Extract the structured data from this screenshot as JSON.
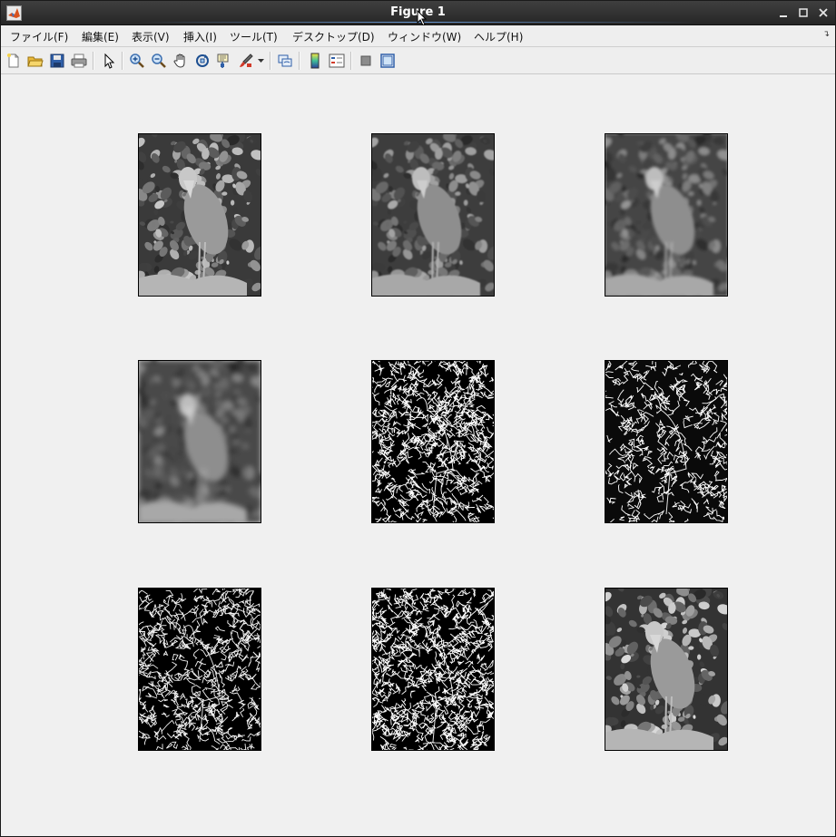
{
  "window": {
    "title": "Figure 1"
  },
  "menu": {
    "items": [
      {
        "label": "ファイル(F)"
      },
      {
        "label": "編集(E)"
      },
      {
        "label": "表示(V)"
      },
      {
        "label": "挿入(I)"
      },
      {
        "label": "ツール(T)"
      },
      {
        "label": "デスクトップ(D)"
      },
      {
        "label": "ウィンドウ(W)"
      },
      {
        "label": "ヘルプ(H)"
      }
    ]
  },
  "toolbar": {
    "buttons": [
      {
        "icon": "new-figure-icon"
      },
      {
        "icon": "open-file-icon"
      },
      {
        "icon": "save-icon"
      },
      {
        "icon": "print-icon"
      },
      {
        "icon": "edit-plot-arrow-icon"
      },
      {
        "icon": "zoom-in-icon"
      },
      {
        "icon": "zoom-out-icon"
      },
      {
        "icon": "pan-hand-icon"
      },
      {
        "icon": "rotate-3d-icon"
      },
      {
        "icon": "data-cursor-icon"
      },
      {
        "icon": "brush-icon"
      },
      {
        "icon": "link-plot-icon"
      },
      {
        "icon": "insert-colorbar-icon"
      },
      {
        "icon": "insert-legend-icon"
      },
      {
        "icon": "hide-plot-tools-icon"
      },
      {
        "icon": "show-plot-tools-icon"
      }
    ]
  },
  "subplots": [
    {
      "variant": "original-gray"
    },
    {
      "variant": "blur-light"
    },
    {
      "variant": "blur-medium"
    },
    {
      "variant": "blur-heavy"
    },
    {
      "variant": "edges-dense"
    },
    {
      "variant": "edges-threshold"
    },
    {
      "variant": "edges-sparse"
    },
    {
      "variant": "edges-white"
    },
    {
      "variant": "sharpened"
    }
  ],
  "colors": {
    "titlebar": "#2e2e2e",
    "figure_bg": "#f0f0f0",
    "matlab_logo": "#d9531e"
  }
}
